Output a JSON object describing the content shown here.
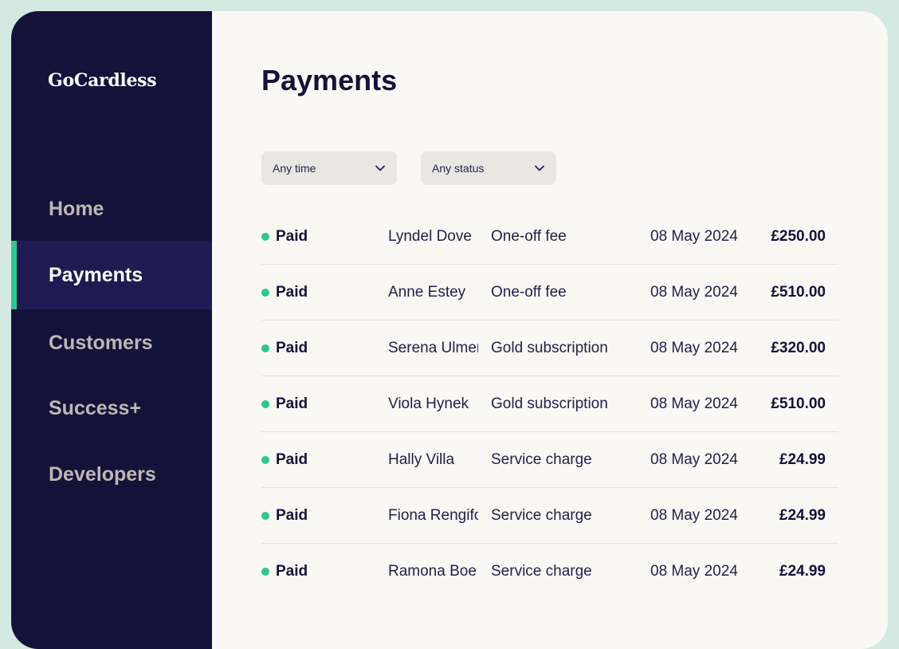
{
  "brand": {
    "logo": "GoCardless"
  },
  "nav": {
    "items": [
      {
        "label": "Home",
        "active": false
      },
      {
        "label": "Payments",
        "active": true
      },
      {
        "label": "Customers",
        "active": false
      },
      {
        "label": "Success+",
        "active": false
      },
      {
        "label": "Developers",
        "active": false
      }
    ]
  },
  "page": {
    "title": "Payments"
  },
  "filters": {
    "time": {
      "value": "Any time",
      "icon": "chevron-down-icon"
    },
    "status": {
      "value": "Any status",
      "icon": "chevron-down-icon"
    }
  },
  "colors": {
    "sidebar_bg": "#15123a",
    "active_bg": "#201a52",
    "accent": "#2fc690",
    "page_bg": "#f9f8f5"
  },
  "payments": {
    "rows": [
      {
        "status": "Paid",
        "name": "Lyndel Dove",
        "description": "One-off fee",
        "date": "08 May 2024",
        "amount": "£250.00"
      },
      {
        "status": "Paid",
        "name": "Anne Estey",
        "description": "One-off fee",
        "date": "08 May 2024",
        "amount": "£510.00"
      },
      {
        "status": "Paid",
        "name": "Serena Ulmer",
        "description": "Gold subscription",
        "date": "08 May 2024",
        "amount": "£320.00"
      },
      {
        "status": "Paid",
        "name": "Viola Hynek",
        "description": "Gold subscription",
        "date": "08 May 2024",
        "amount": "£510.00"
      },
      {
        "status": "Paid",
        "name": "Hally Villa",
        "description": "Service charge",
        "date": "08 May 2024",
        "amount": "£24.99"
      },
      {
        "status": "Paid",
        "name": "Fiona Rengifo",
        "description": "Service charge",
        "date": "08 May 2024",
        "amount": "£24.99"
      },
      {
        "status": "Paid",
        "name": "Ramona Boe",
        "description": "Service charge",
        "date": "08 May 2024",
        "amount": "£24.99"
      }
    ]
  }
}
